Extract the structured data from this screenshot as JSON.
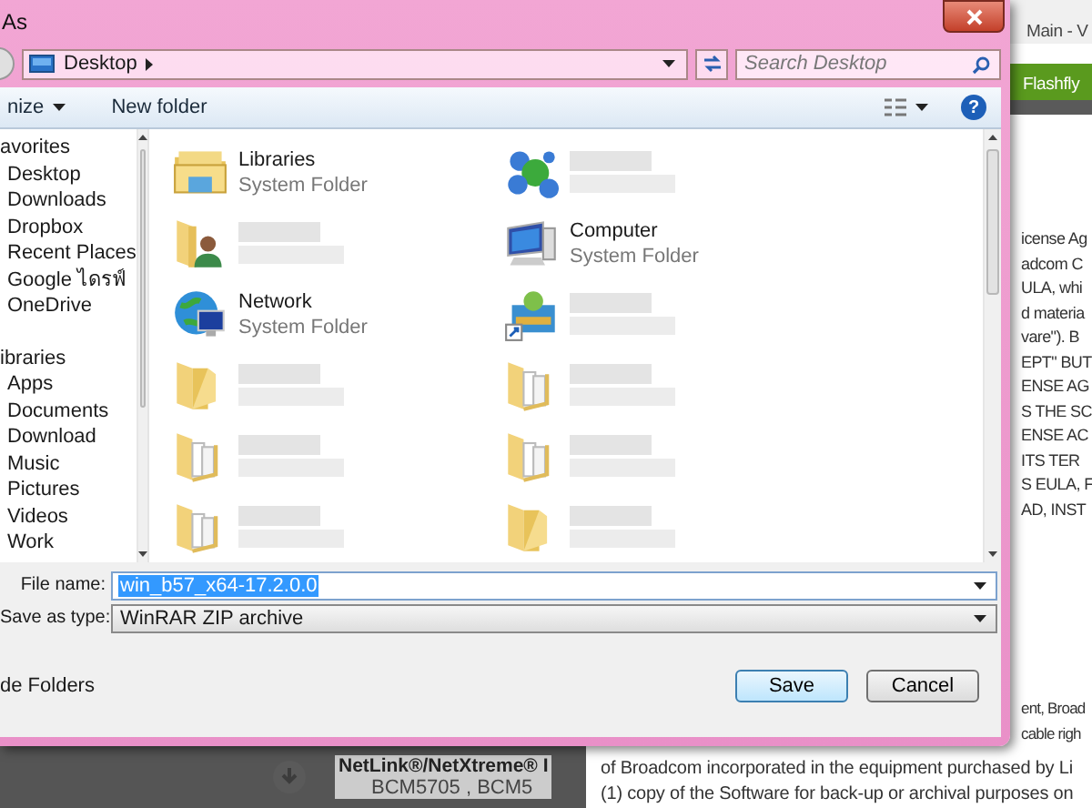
{
  "background_page": {
    "tab_title": "Main - V",
    "menu_item": "Flashfly",
    "license_lines": [
      "icense Ag",
      "adcom C",
      "ULA, whi",
      "d materia",
      "vare\"). B",
      "EPT\" BUT",
      "ENSE AG",
      "S THE SC",
      "ENSE AC",
      "ITS TER",
      "S EULA, F",
      "AD, INST"
    ],
    "lower_lines": [
      "ent, Broad",
      "cable righ"
    ],
    "product_title": "NetLink®/NetXtreme® I",
    "product_models": "BCM5705 , BCM5",
    "bottom_lines": [
      "of Broadcom incorporated in the equipment purchased by Li",
      "(1) copy of the Software for back-up or archival purposes on"
    ]
  },
  "dialog": {
    "title": "As",
    "address": {
      "location": "Desktop"
    },
    "search": {
      "placeholder": "Search Desktop"
    },
    "toolbar": {
      "organize": "nize",
      "new_folder": "New folder",
      "help": "?"
    },
    "navigation": [
      {
        "label": "avorites",
        "children": [
          {
            "label": "Desktop"
          },
          {
            "label": "Downloads"
          },
          {
            "label": "Dropbox"
          },
          {
            "label": "Recent Places"
          },
          {
            "label": "Google ไดรฟ์"
          },
          {
            "label": "OneDrive"
          }
        ]
      },
      {
        "label": "ibraries",
        "children": [
          {
            "label": "Apps"
          },
          {
            "label": "Documents"
          },
          {
            "label": "Download"
          },
          {
            "label": "Music"
          },
          {
            "label": "Pictures"
          },
          {
            "label": "Videos"
          },
          {
            "label": "Work"
          }
        ]
      }
    ],
    "files": [
      {
        "kind": "libraries",
        "name": "Libraries",
        "type": "System Folder"
      },
      {
        "kind": "molecule",
        "blurred": true
      },
      {
        "kind": "user",
        "blurred": true
      },
      {
        "kind": "computer",
        "name": "Computer",
        "type": "System Folder"
      },
      {
        "kind": "network",
        "name": "Network",
        "type": "System Folder"
      },
      {
        "kind": "shortcut",
        "blurred": true
      },
      {
        "kind": "folder",
        "blurred": true
      },
      {
        "kind": "docs",
        "blurred": true
      },
      {
        "kind": "docs",
        "blurred": true
      },
      {
        "kind": "docs",
        "blurred": true
      },
      {
        "kind": "docs",
        "blurred": true
      },
      {
        "kind": "folder",
        "blurred": true
      }
    ],
    "file_name": {
      "label": "File name:",
      "value": "win_b57_x64-17.2.0.0",
      "selected": true
    },
    "save_as_type": {
      "label": "Save as type:",
      "value": "WinRAR ZIP archive"
    },
    "hide_folders": "de Folders",
    "buttons": [
      {
        "label": "Save",
        "default": true
      },
      {
        "label": "Cancel",
        "default": false
      }
    ]
  }
}
